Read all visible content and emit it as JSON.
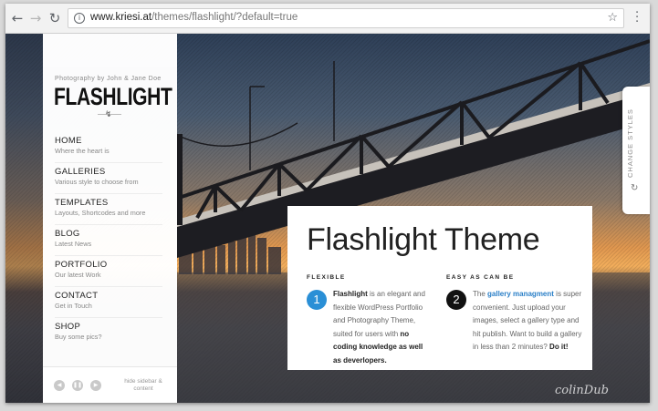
{
  "browser": {
    "url_host": "www.kriesi.at",
    "url_path": "/themes/flashlight/?default=true",
    "back_icon": "arrow-left",
    "forward_icon": "arrow-right",
    "reload_icon": "reload",
    "star_icon": "star",
    "menu_icon": "vertical-dots"
  },
  "sidebar": {
    "byline": "Photography by John & Jane Doe",
    "logo": "FLASHLIGHT",
    "nav": [
      {
        "title": "HOME",
        "sub": "Where the heart is"
      },
      {
        "title": "GALLERIES",
        "sub": "Various style to choose from"
      },
      {
        "title": "TEMPLATES",
        "sub": "Layouts, Shortcodes and more"
      },
      {
        "title": "BLOG",
        "sub": "Latest News"
      },
      {
        "title": "PORTFOLIO",
        "sub": "Our latest Work"
      },
      {
        "title": "CONTACT",
        "sub": "Get in Touch"
      },
      {
        "title": "SHOP",
        "sub": "Buy some pics?"
      }
    ],
    "hide_label": "hide sidebar & content"
  },
  "card": {
    "title": "Flashlight Theme",
    "col1": {
      "heading": "FLEXIBLE",
      "number": "1",
      "strong1": "Flashlight",
      "text1": " is an elegant and flexible WordPress Portfolio and Photography Theme, suited for users with ",
      "strong2": "no coding knowledge as well as deverlopers."
    },
    "col2": {
      "heading": "EASY AS CAN BE",
      "number": "2",
      "text1": "The ",
      "link": "gallery managment",
      "text2": " is super convenient. Just upload your images, select a gallery type and hit publish. Want to build a gallery in less than 2 minutes? ",
      "strong": "Do it!"
    }
  },
  "styles_tab": {
    "label": "CHANGE STYLES"
  },
  "signature": "colinDub",
  "colors": {
    "accent_blue": "#2a8fd6",
    "dark": "#111111"
  }
}
